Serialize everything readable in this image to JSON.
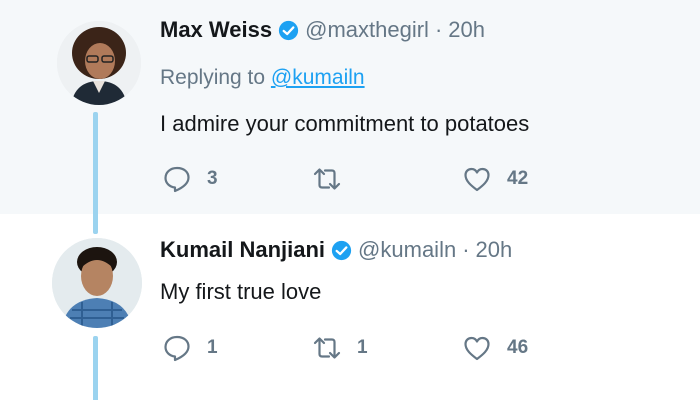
{
  "tweets": [
    {
      "name": "Max Weiss",
      "handle": "@maxthegirl",
      "separator": "·",
      "time": "20h",
      "replying_prefix": "Replying to",
      "replying_to": "@kumailn",
      "text": "I admire your commitment to potatoes",
      "replies": "3",
      "retweets": "",
      "likes": "42"
    },
    {
      "name": "Kumail Nanjiani",
      "handle": "@kumailn",
      "separator": "·",
      "time": "20h",
      "text": "My first true love",
      "replies": "1",
      "retweets": "1",
      "likes": "46"
    }
  ],
  "colors": {
    "accent": "#1da1f2",
    "muted": "#657786",
    "thread_line": "#9bd3ef",
    "first_tweet_bg": "#f5f8fa"
  },
  "icons": [
    "verified-badge-icon",
    "reply-icon",
    "retweet-icon",
    "like-heart-icon"
  ]
}
